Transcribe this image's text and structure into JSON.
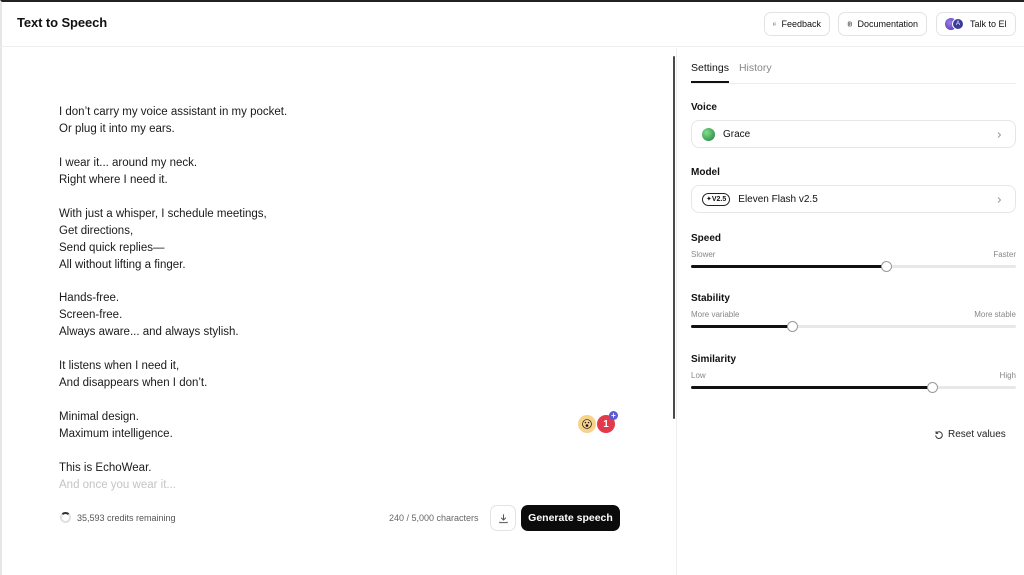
{
  "header": {
    "title": "Text to Speech",
    "feedback_label": "Feedback",
    "docs_label": "Documentation",
    "talk_label": "Talk to El",
    "talk_avatar_initial": "A"
  },
  "editor": {
    "paragraphs": [
      [
        "I don’t carry my voice assistant in my pocket.",
        "Or plug it into my ears."
      ],
      [
        "I wear it... around my neck.",
        "Right where I need it."
      ],
      [
        "With just a whisper, I schedule meetings,",
        "Get directions,",
        "Send quick replies—",
        "All without lifting a finger."
      ],
      [
        "Hands-free.",
        "Screen-free.",
        "Always aware... and always stylish."
      ],
      [
        "It listens when I need it,",
        "And disappears when I don’t."
      ],
      [
        "Minimal design.",
        "Maximum intelligence."
      ],
      [
        "This is EchoWear."
      ]
    ],
    "faded_line": "And once you wear it...",
    "notification_count": "1",
    "notification_plus": "+"
  },
  "footer": {
    "credits": "35,593 credits remaining",
    "char_count": "240 / 5,000 characters",
    "generate_label": "Generate speech"
  },
  "panel": {
    "tabs": [
      {
        "label": "Settings",
        "active": true
      },
      {
        "label": "History",
        "active": false
      }
    ],
    "voice": {
      "label": "Voice",
      "value": "Grace"
    },
    "model": {
      "label": "Model",
      "badge": "V2.5",
      "value": "Eleven Flash v2.5"
    },
    "sliders": [
      {
        "label": "Speed",
        "min_label": "Slower",
        "max_label": "Faster",
        "value": 0.6
      },
      {
        "label": "Stability",
        "min_label": "More variable",
        "max_label": "More stable",
        "value": 0.31
      },
      {
        "label": "Similarity",
        "min_label": "Low",
        "max_label": "High",
        "value": 0.74
      }
    ],
    "reset_label": "Reset values"
  },
  "colors": {
    "accent": "#0b0b0b",
    "notification": "#e23a4b",
    "plus_badge": "#5b5bd6"
  },
  "icons": {
    "feedback": "chat-bubble-icon",
    "docs": "document-icon",
    "download": "download-icon",
    "chevron": "chevron-right-icon",
    "reset": "rotate-ccw-icon",
    "emoji": "emoji-face-icon"
  }
}
